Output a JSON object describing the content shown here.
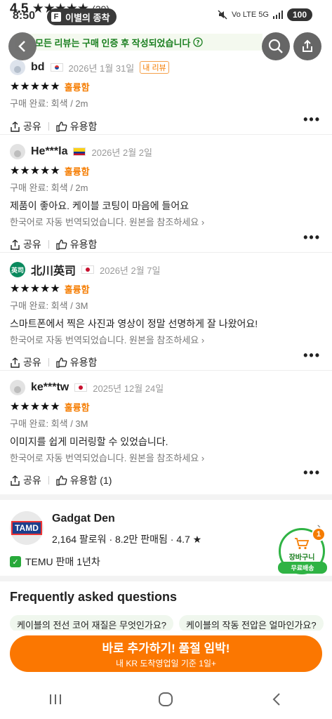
{
  "status": {
    "time": "8:50",
    "app_pill": "이별의 종착",
    "app_pill_icon": "F",
    "network": "Vo LTE 5G",
    "battery": "100"
  },
  "header": {
    "rating": "4.5",
    "stars": "★★★★★",
    "count": "(29)",
    "notice": "모든 리뷰는 구매 인증 후 작성되었습니다",
    "icons": [
      "back-arrow-icon",
      "search-icon",
      "share-icon"
    ]
  },
  "reviews": [
    {
      "name": "bd",
      "flag": "kr",
      "date": "2026년 1월 31일",
      "badge": "내 리뷰",
      "stars": "★★★★★",
      "grade": "훌륭함",
      "meta": "구매 완료: 회색 / 2m",
      "text": "",
      "translated": "",
      "share": "공유",
      "helpful": "유용함"
    },
    {
      "name": "He***la",
      "flag": "co",
      "date": "2026년 2월 2일",
      "stars": "★★★★★",
      "grade": "훌륭함",
      "meta": "구매 완료: 회색 / 2m",
      "text": "제품이 좋아요. 케이블 코팅이 마음에 들어요",
      "translated": "한국어로 자동 번역되었습니다.  원본을 참조하세요 ›",
      "share": "공유",
      "helpful": "유용함"
    },
    {
      "name": "北川英司",
      "avatar_text": "英司",
      "flag": "jp",
      "date": "2026년 2월 7일",
      "stars": "★★★★★",
      "grade": "훌륭함",
      "meta": "구매 완료: 회색 / 3M",
      "text": "스마트폰에서 찍은 사진과 영상이 정말 선명하게 잘 나왔어요!",
      "translated": "한국어로 자동 번역되었습니다.  원본을 참조하세요 ›",
      "share": "공유",
      "helpful": "유용함"
    },
    {
      "name": "ke***tw",
      "flag": "jp",
      "date": "2025년 12월 24일",
      "stars": "★★★★★",
      "grade": "훌륭함",
      "meta": "구매 완료: 회색 / 3M",
      "text": "이미지를 쉽게 미러링할 수 있었습니다.",
      "translated": "한국어로 자동 번역되었습니다.  원본을 참조하세요 ›",
      "share": "공유",
      "helpful": "유용함 (1)"
    }
  ],
  "store": {
    "logo_text": "TAMD",
    "name": "Gadgat Den",
    "stats": "2,164 팔로워  ·  8.2만 판매됨  ·  4.7 ★",
    "temu_years": "TEMU 판매 1년차",
    "calendar_icon_text": "✓"
  },
  "cart": {
    "count": "1",
    "label": "장바구니",
    "free_shipping": "무료배송"
  },
  "faq": {
    "title": "Frequently asked questions",
    "chips": [
      "케이블의 전선 코어 재질은 무엇인가요?",
      "케이블의 작동 전압은 얼마인가요?"
    ]
  },
  "cta": {
    "main": "바로 추가하기! 품절 임박!",
    "sub": "내 KR 도착영업일 기준 1일+"
  },
  "colors": {
    "accent": "#fb7701",
    "green": "#2fb344",
    "grade": "#f57c00"
  }
}
